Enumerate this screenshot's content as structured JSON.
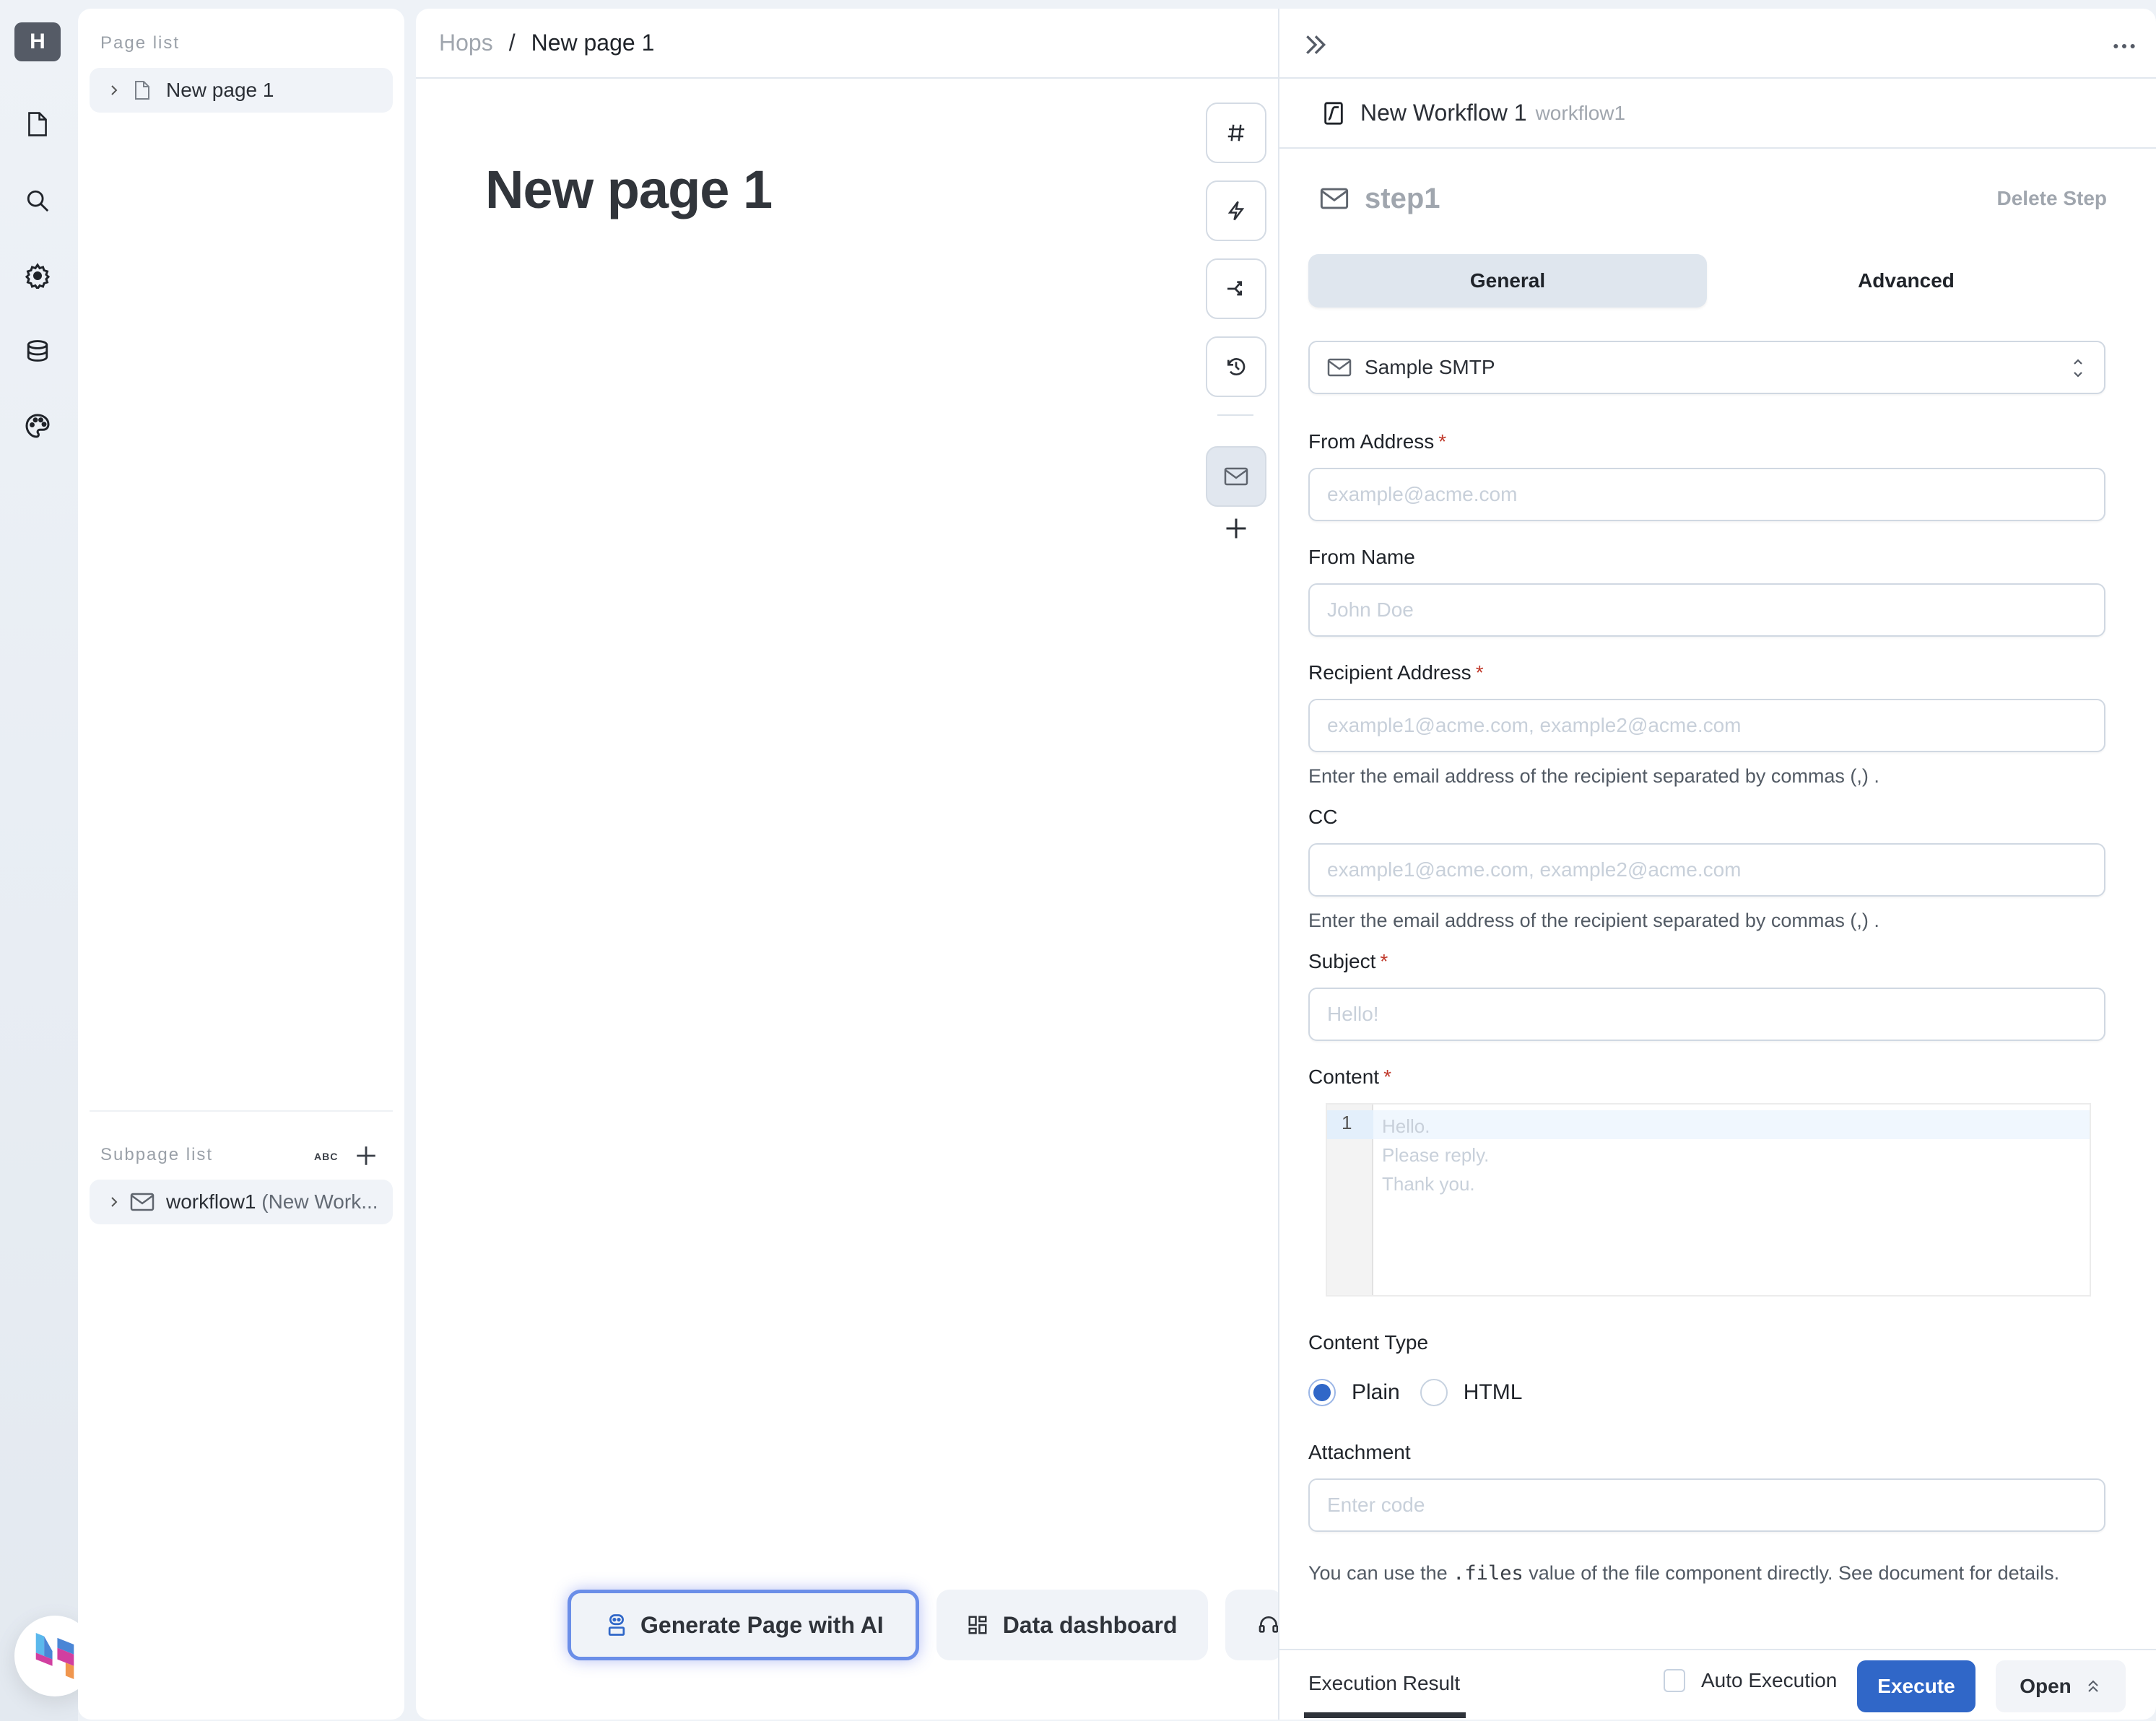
{
  "rail": {
    "avatar_letter": "H",
    "icons": [
      "file-icon",
      "search-icon",
      "gear-icon",
      "database-icon",
      "palette-icon"
    ]
  },
  "page_list": {
    "title": "Page list",
    "items": [
      {
        "label": "New page 1",
        "icon": "file-icon"
      }
    ]
  },
  "subpage_list": {
    "title": "Subpage list",
    "sort_label": "ABC",
    "items": [
      {
        "label": "workflow1",
        "suffix": "(New Work...",
        "icon": "mail-icon"
      }
    ]
  },
  "main": {
    "breadcrumb": {
      "root": "Hops",
      "separator": "/",
      "current": "New page 1"
    },
    "page_title": "New page 1",
    "tools": [
      "hash-icon",
      "lightning-icon",
      "branch-icon",
      "history-icon",
      "mail-icon"
    ],
    "actions": [
      {
        "label": "Generate Page with AI",
        "icon": "robot-icon"
      },
      {
        "label": "Data dashboard",
        "icon": "dashboard-icon"
      },
      {
        "label": "",
        "icon": "support-icon"
      }
    ]
  },
  "workflow": {
    "title": "New Workflow 1",
    "id": "workflow1",
    "step_name": "step1",
    "delete_step_label": "Delete Step",
    "tabs": [
      {
        "label": "General",
        "active": true
      },
      {
        "label": "Advanced",
        "active": false
      }
    ],
    "smtp_select": {
      "value": "Sample SMTP"
    },
    "fields": {
      "from_address": {
        "label": "From Address",
        "required": "*",
        "placeholder": "example@acme.com",
        "value": ""
      },
      "from_name": {
        "label": "From Name",
        "placeholder": "John Doe",
        "value": ""
      },
      "recipient": {
        "label": "Recipient Address",
        "required": "*",
        "placeholder": "example1@acme.com, example2@acme.com",
        "value": "",
        "help": "Enter the email address of the recipient separated by commas (,) ."
      },
      "cc": {
        "label": "CC",
        "placeholder": "example1@acme.com, example2@acme.com",
        "value": "",
        "help": "Enter the email address of the recipient separated by commas (,) ."
      },
      "subject": {
        "label": "Subject",
        "required": "*",
        "placeholder": "Hello!",
        "value": ""
      },
      "content": {
        "label": "Content",
        "required": "*",
        "line_number": "1",
        "placeholder": "Hello.\nPlease reply.\nThank you."
      },
      "content_type": {
        "label": "Content Type",
        "options": [
          {
            "label": "Plain",
            "selected": true
          },
          {
            "label": "HTML",
            "selected": false
          }
        ]
      },
      "attachment": {
        "label": "Attachment",
        "placeholder": "Enter code",
        "value": "",
        "help_prefix": "You can use the ",
        "help_code": ".files",
        "help_middle": " value of the file component directly. See ",
        "help_link": "document",
        "help_suffix": " for details."
      }
    },
    "footer": {
      "tab_label": "Execution Result",
      "auto_execution_label": "Auto Execution",
      "auto_execution_checked": false,
      "execute_label": "Execute",
      "open_label": "Open"
    }
  },
  "colors": {
    "accent": "#3067c8",
    "required": "#c0392b",
    "active_tab": "#dfe6ee"
  }
}
